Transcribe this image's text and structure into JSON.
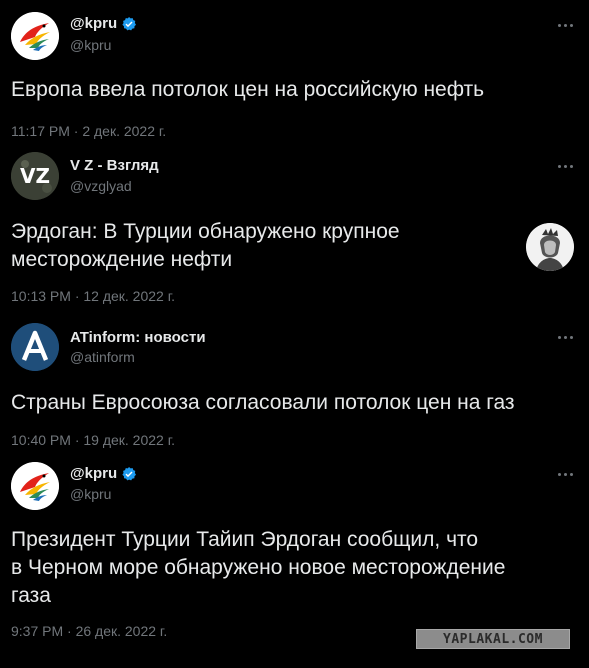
{
  "colors": {
    "background": "#000000",
    "text": "#e7e9ea",
    "secondary": "#71767b",
    "verified": "#1d9bf0",
    "kpru_avatar_bg": "#ffffff",
    "vz_avatar_bg": "#3b4035",
    "atinform_avatar_bg": "#1f4e7a"
  },
  "tweets": [
    {
      "name": "@kpru",
      "handle": "@kpru",
      "verified": true,
      "avatar_icon": "kpru-bird-logo-icon",
      "text": "Европа ввела потолок цен на российскую нефть",
      "meta": "11:17 PM · 2 дек. 2022 г."
    },
    {
      "name": "V Z - Взгляд",
      "handle": "@vzglyad",
      "verified": false,
      "avatar_icon": "vz-logo-icon",
      "text": "Эрдоган: В Турции обнаружено крупное\nместорождение нефти",
      "meta": "10:13 PM · 12 дек. 2022 г.",
      "thumbnail_icon": "engraved-portrait-icon"
    },
    {
      "name": "ATinform: новости",
      "handle": "@atinform",
      "verified": false,
      "avatar_icon": "atinform-a-logo-icon",
      "text": "Страны Евросоюза согласовали потолок цен на газ",
      "meta": "10:40 PM · 19 дек. 2022 г."
    },
    {
      "name": "@kpru",
      "handle": "@kpru",
      "verified": true,
      "avatar_icon": "kpru-bird-logo-icon",
      "text": "Президент Турции Тайип Эрдоган сообщил, что\nв Черном море обнаружено новое месторождение\nгаза",
      "meta": "9:37 PM · 26 дек. 2022 г."
    }
  ],
  "watermark": "YAPLAKAL.COM"
}
